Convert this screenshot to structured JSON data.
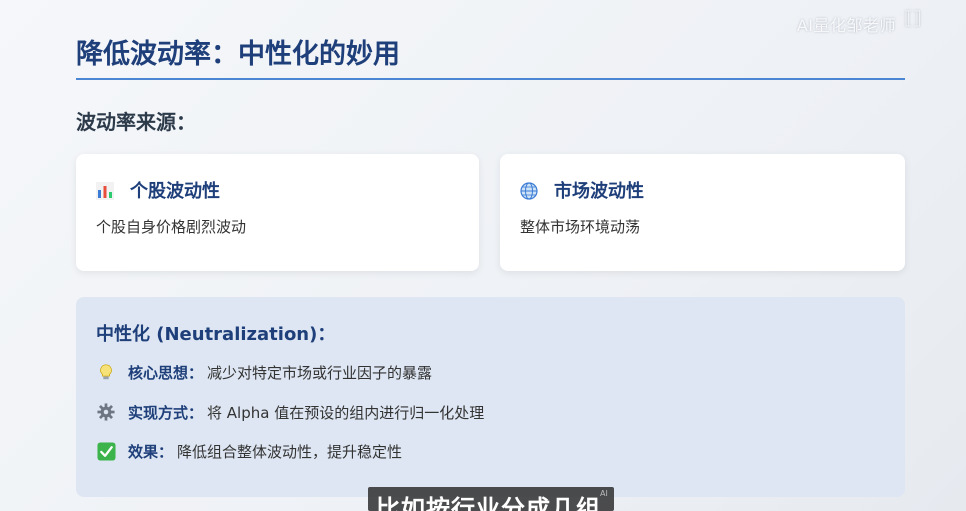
{
  "watermark": "AI量化邹老师",
  "title": "降低波动率：中性化的妙用",
  "subhead": "波动率来源：",
  "cards": [
    {
      "icon": "bar-chart-icon",
      "title": "个股波动性",
      "desc": "个股自身价格剧烈波动"
    },
    {
      "icon": "globe-icon",
      "title": "市场波动性",
      "desc": "整体市场环境动荡"
    }
  ],
  "neutralization": {
    "title": "中性化 (Neutralization)：",
    "items": [
      {
        "icon": "lightbulb-icon",
        "label": "核心思想：",
        "text": "减少对特定市场或行业因子的暴露"
      },
      {
        "icon": "gear-icon",
        "label": "实现方式：",
        "text": "将 Alpha 值在预设的组内进行归一化处理"
      },
      {
        "icon": "checkmark-icon",
        "label": "效果：",
        "text": "降低组合整体波动性，提升稳定性"
      }
    ]
  },
  "caption": "比如按行业分成几组",
  "caption_badge": "AI",
  "colors": {
    "title": "#1e3f7a",
    "rule": "#4a86d4",
    "panel_bg": "#dde6f2",
    "check_green": "#3cb44b"
  }
}
